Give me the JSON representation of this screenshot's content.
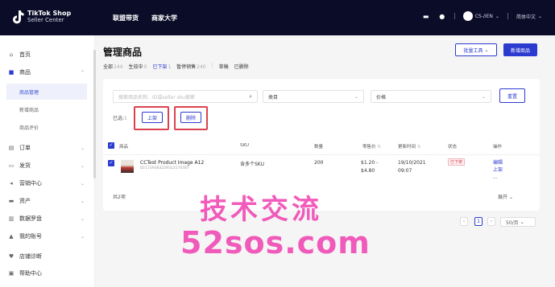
{
  "brand": {
    "line1": "TikTok Shop",
    "line2": "Seller Center"
  },
  "topnav": {
    "item1": "联盟带货",
    "item2": "商家大学"
  },
  "account": {
    "name": "CS-/IEN",
    "language": "简体中文"
  },
  "sidebar": {
    "items": [
      {
        "label": "首页",
        "icon": "home-icon"
      },
      {
        "label": "商品",
        "icon": "product-icon"
      },
      {
        "label": "订单",
        "icon": "order-icon"
      },
      {
        "label": "发货",
        "icon": "shipping-icon"
      },
      {
        "label": "营销中心",
        "icon": "marketing-icon"
      },
      {
        "label": "资产",
        "icon": "asset-icon"
      },
      {
        "label": "数据罗盘",
        "icon": "data-icon"
      },
      {
        "label": "我的账号",
        "icon": "account-icon"
      },
      {
        "label": "店铺诊断",
        "icon": "diagnosis-icon"
      },
      {
        "label": "帮助中心",
        "icon": "help-icon"
      }
    ],
    "subitems": [
      "商品管理",
      "新增商品",
      "商品评价"
    ]
  },
  "page": {
    "title": "管理商品",
    "bulk_tool": "批量工具",
    "add_product": "新增商品"
  },
  "status_tabs": [
    {
      "label": "全部",
      "count": "244"
    },
    {
      "label": "生效中",
      "count": "0"
    },
    {
      "label": "已下架",
      "count": "1"
    },
    {
      "label": "暂停销售",
      "count": "240"
    },
    {
      "label": "草稿",
      "count": ""
    },
    {
      "label": "已删除",
      "count": ""
    }
  ],
  "filters": {
    "search_placeholder": "搜索商品名称、ID或seller sku搜索",
    "category": "类目",
    "price": "价格",
    "reset": "重置"
  },
  "selection": {
    "label": "已选:",
    "count": "1",
    "list_button": "上架",
    "delete_button": "删除"
  },
  "table": {
    "headers": {
      "product": "商品",
      "sku": "SKU",
      "quantity": "数量",
      "price": "零售价",
      "updated": "更新时间",
      "status": "状态",
      "ops": "操作"
    },
    "rows": [
      {
        "name": "CCTest Product Image A12",
        "id": "ID:1729383229312174787",
        "sku": "含多个SKU",
        "quantity": "200",
        "price_low": "$1.20 -",
        "price_high": "$4.80",
        "date": "19/10/2021",
        "time": "09:07",
        "status": "已下架",
        "op_edit": "编辑",
        "op_list": "上架",
        "op_more": "..."
      }
    ],
    "total": "共2项",
    "expand": "展开"
  },
  "pagination": {
    "current": "1",
    "page_size": "50/页"
  },
  "watermark": {
    "line1": "技术交流",
    "line2": "52sos.com"
  },
  "colors": {
    "accent": "#2b3bd0",
    "highlight": "#d9434f",
    "topbar": "#0b0d28",
    "watermark": "#f03fb0"
  }
}
